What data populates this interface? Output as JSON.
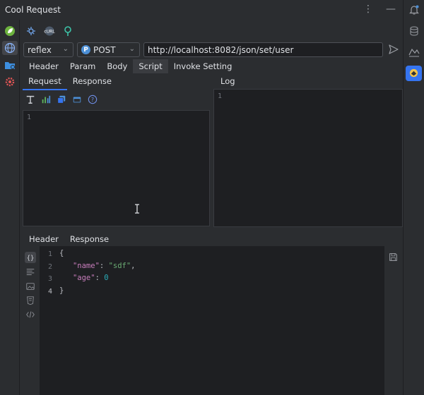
{
  "app": {
    "title": "Cool Request"
  },
  "request": {
    "env_value": "reflex",
    "method": "POST",
    "method_badge": "P",
    "url": "http://localhost:8082/json/set/user"
  },
  "top_tabs": [
    "Header",
    "Param",
    "Body",
    "Script",
    "Invoke Setting"
  ],
  "script": {
    "subtabs": [
      "Request",
      "Response"
    ],
    "editor_line": "1",
    "log_title": "Log",
    "log_line": "1"
  },
  "response": {
    "tabs": [
      "Header",
      "Response"
    ],
    "line_numbers": [
      "1",
      "2",
      "3",
      "4"
    ],
    "json": {
      "open": "{",
      "key1": "\"name\"",
      "val1": "\"sdf\"",
      "key2": "\"age\"",
      "val2": "0",
      "close": "}"
    }
  },
  "colors": {
    "accent": "#3574f0",
    "method_badge": "#4c8fd6",
    "string": "#6aab73",
    "number": "#2aacb8"
  }
}
